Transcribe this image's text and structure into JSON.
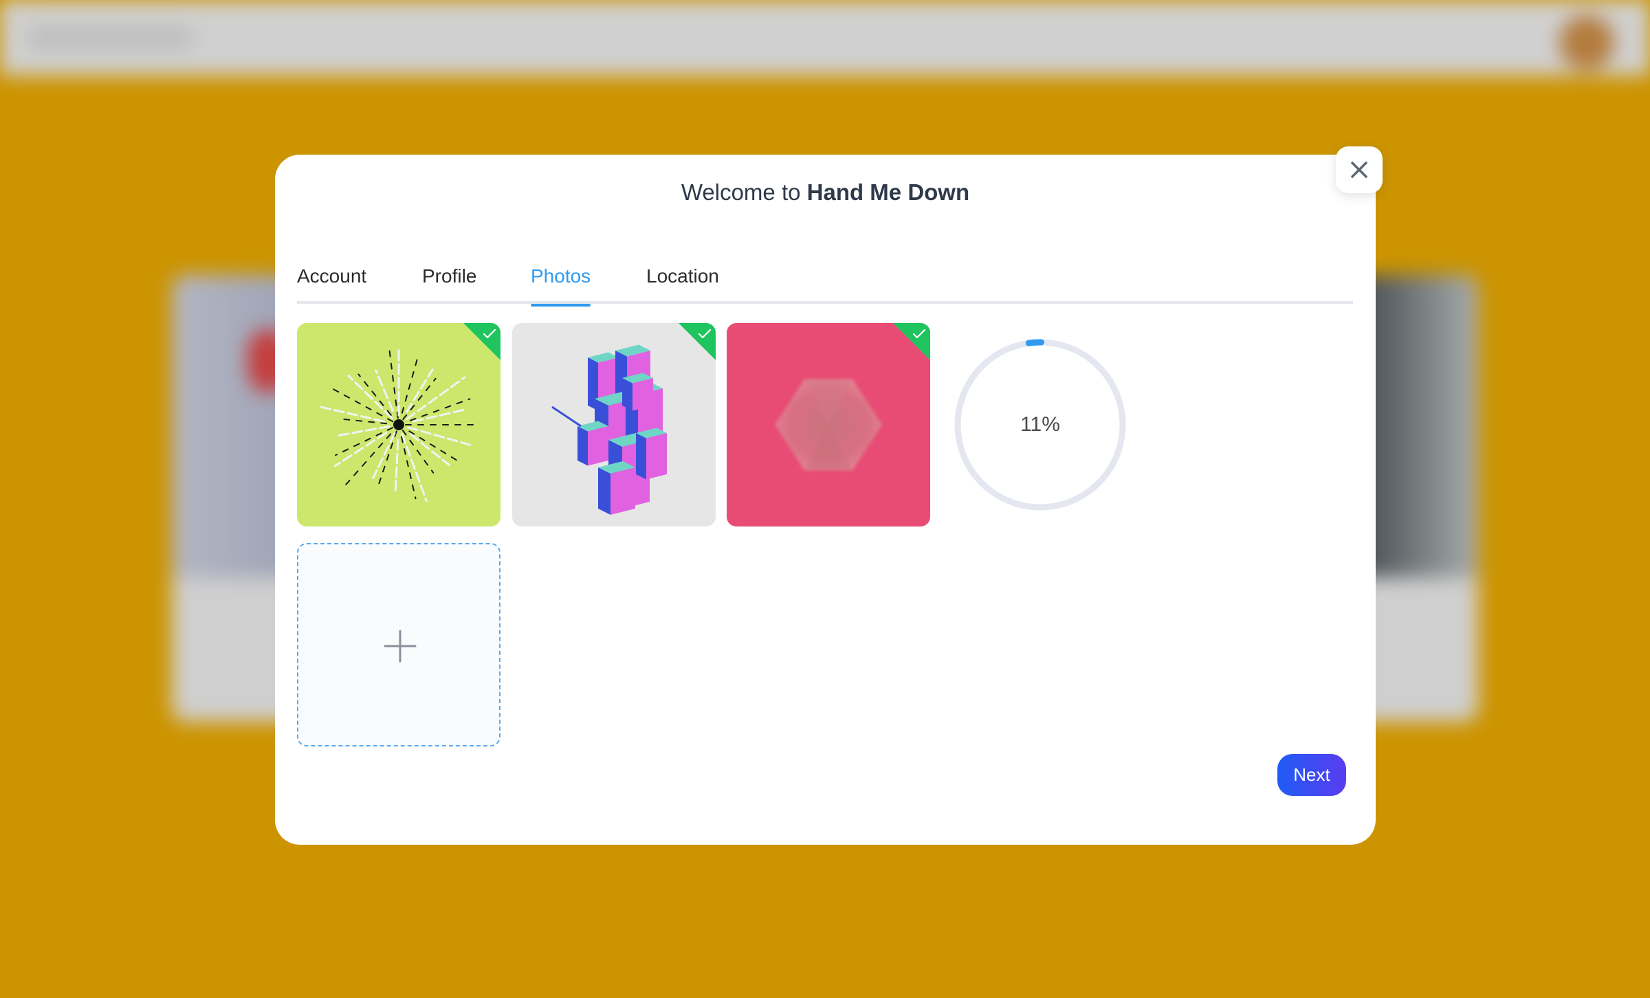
{
  "modal": {
    "title_prefix": "Welcome to",
    "title_brand": "Hand Me Down",
    "close_icon": "close-icon"
  },
  "tabs": [
    {
      "label": "Account",
      "active": false
    },
    {
      "label": "Profile",
      "active": false
    },
    {
      "label": "Photos",
      "active": true
    },
    {
      "label": "Location",
      "active": false
    }
  ],
  "photos": [
    {
      "name": "starburst-photo",
      "background": "#cce76c",
      "selected": true
    },
    {
      "name": "isometric-blocks-photo",
      "background": "#e6e6e6",
      "selected": true
    },
    {
      "name": "pink-hexagon-photo",
      "background": "#e84c74",
      "selected": true
    }
  ],
  "upload": {
    "progress": 0.11,
    "progress_label": "11%",
    "add_icon": "plus-icon"
  },
  "actions": {
    "next_label": "Next"
  },
  "colors": {
    "accent": "#2f9bf0",
    "check": "#1fc45e",
    "page_background": "#cc9400",
    "next_gradient_start": "#1f5cf5",
    "next_gradient_end": "#5a3cf0"
  }
}
